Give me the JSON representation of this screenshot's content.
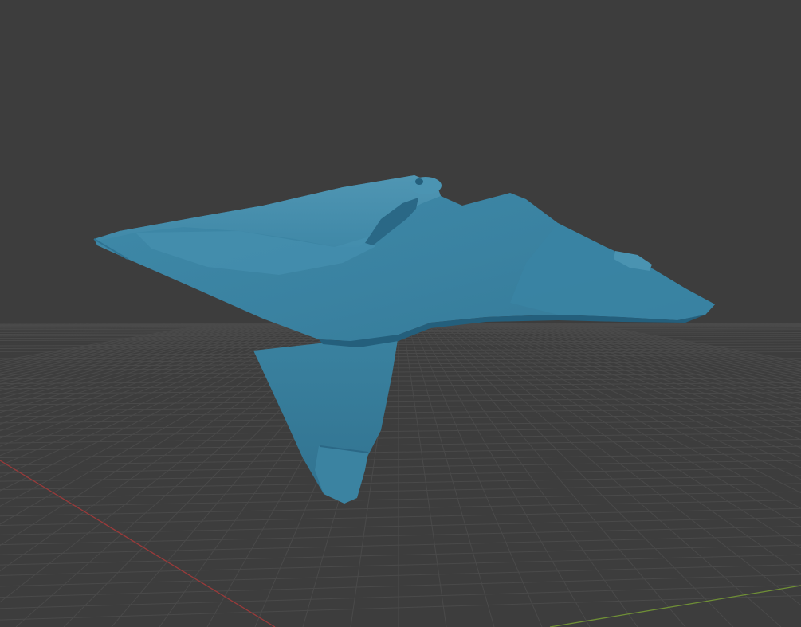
{
  "viewport": {
    "background_color": "#3d3d3d",
    "grid_color": "#4a4a4a",
    "x_axis_color": "#9a3a3a",
    "y_axis_color": "#6f8f36",
    "object": {
      "name": "",
      "shading": "solid",
      "color": "#3d87a6",
      "highlight_color": "#5aa6c4",
      "shadow_color": "#2b6886"
    }
  }
}
